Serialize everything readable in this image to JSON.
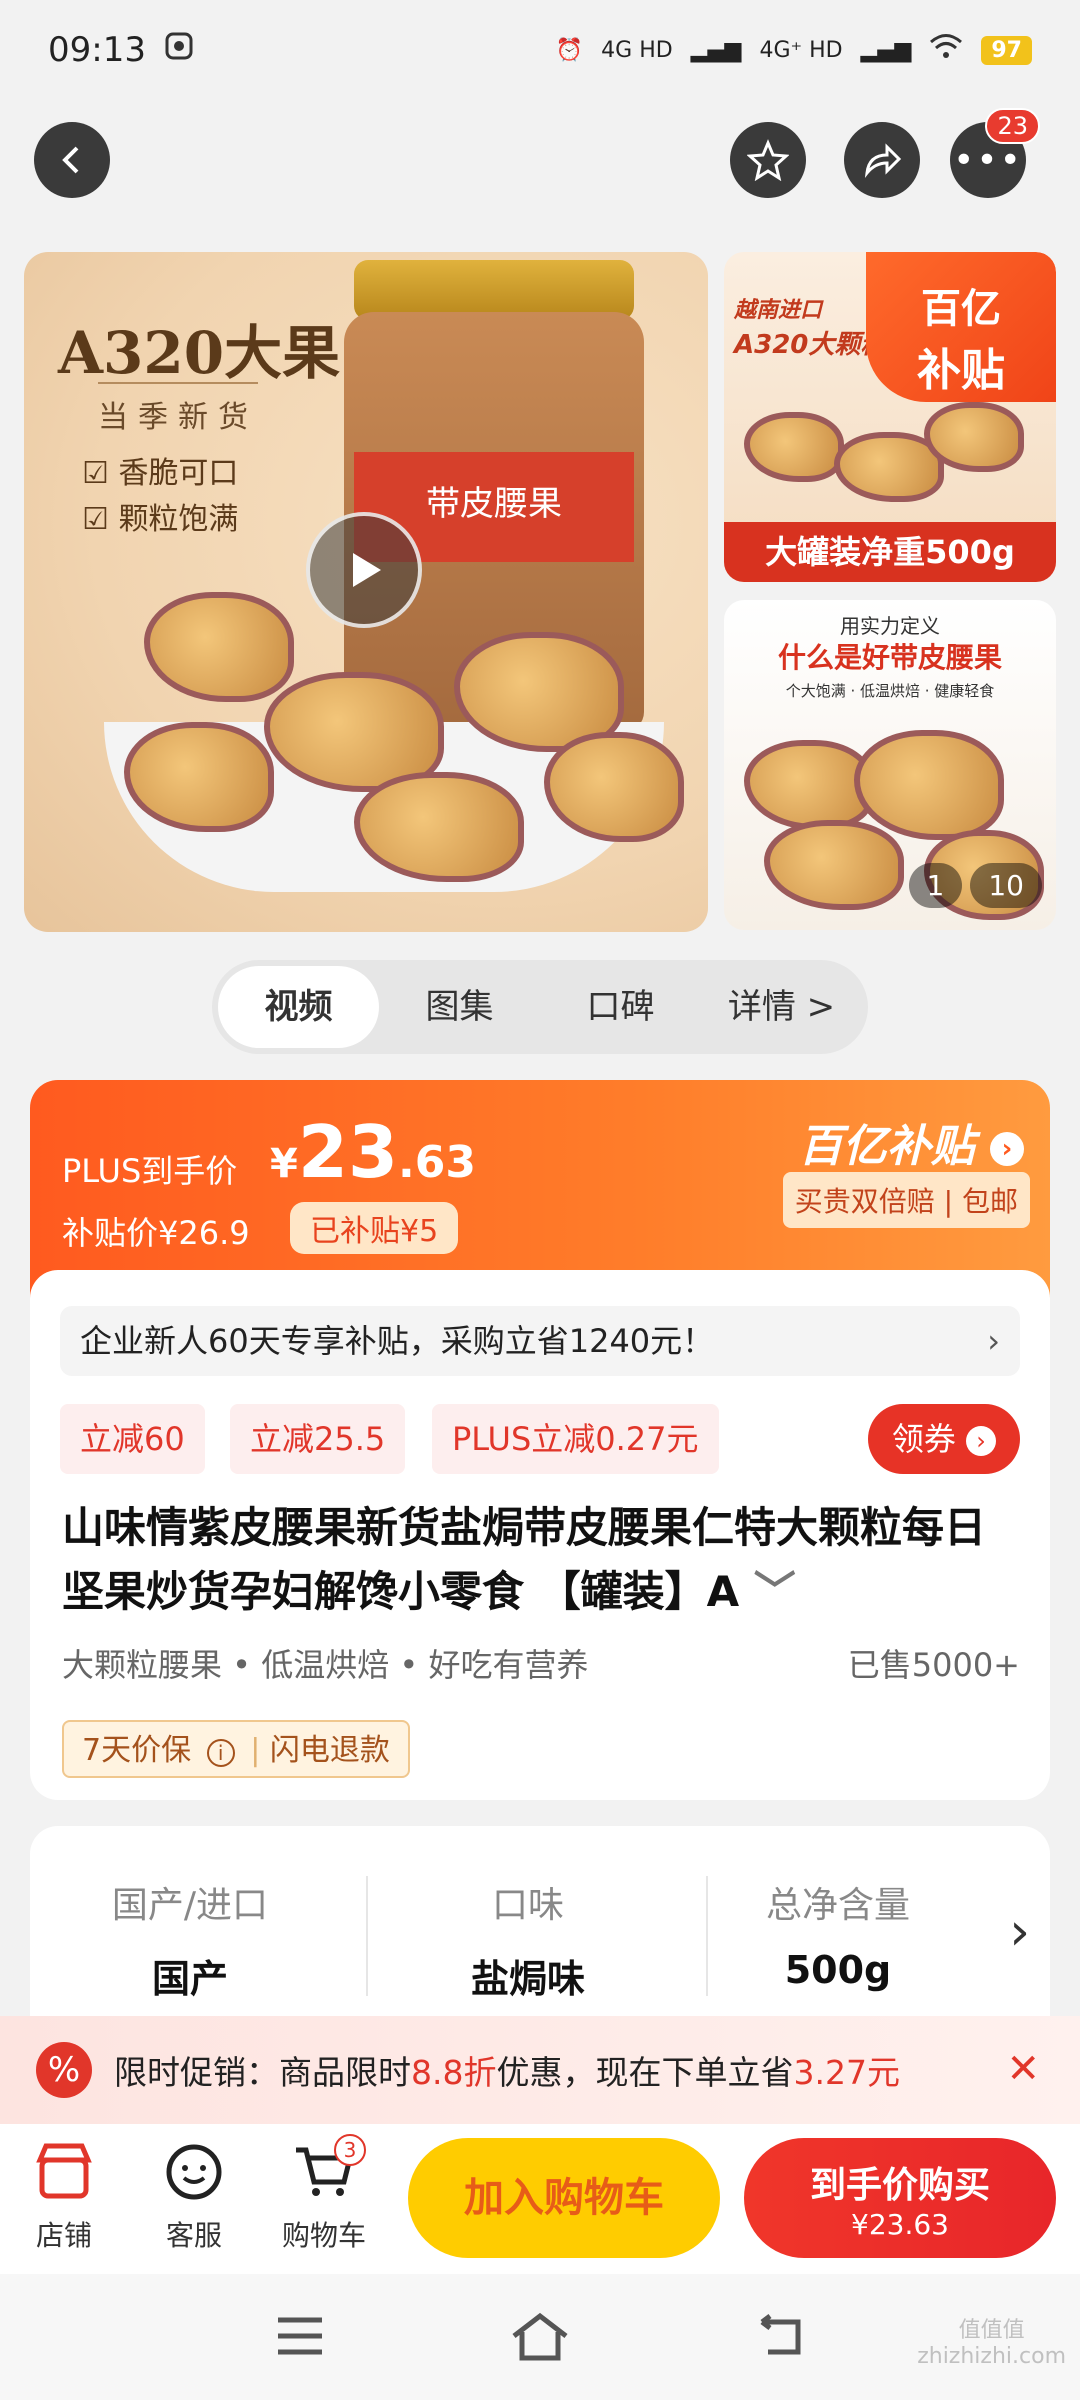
{
  "status": {
    "time": "09:13",
    "network1": "4G HD",
    "network2": "4G⁺ HD",
    "battery": "97"
  },
  "topnav": {
    "notif_count": "23"
  },
  "gallery": {
    "main_title": "A320大果",
    "main_sub": "当季新货",
    "bullet1": "香脆可口",
    "bullet2": "颗粒饱满",
    "jar_label": "带皮腰果",
    "side1_line1": "越南进口",
    "side1_line2": "A320大颗粒",
    "side1_banner": "大罐装净重500g",
    "side2_line1": "用实力定义",
    "side2_line2": "什么是好带皮腰果",
    "side2_tags": "个大饱满 · 低温烘焙 · 健康轻食",
    "subsidy_tag_line1": "百亿",
    "subsidy_tag_line2": "补贴",
    "pager_current": "1",
    "pager_total": "10"
  },
  "tabs": [
    "视频",
    "图集",
    "口碑",
    "详情 >"
  ],
  "price": {
    "plus_label": "PLUS到手价",
    "currency": "¥",
    "integer": "23",
    "decimal": ".63",
    "sub_price": "补贴价¥26.9",
    "subsidized": "已补贴¥5",
    "billion": "百亿补贴",
    "guarantee": "买贵双倍赔 | 包邮"
  },
  "notice": {
    "text": "企业新人60天专享补贴，采购立省1240元！",
    "chevron": "›"
  },
  "coupons": [
    "立减60",
    "立减25.5",
    "PLUS立减0.27元"
  ],
  "get_coupon": "领券",
  "product_title": "山味情紫皮腰果新货盐焗带皮腰果仁特大颗粒每日坚果炒货孕妇解馋小零食 【罐装】A",
  "tags": "大颗粒腰果 • 低温烘焙 • 好吃有营养",
  "sold": "已售5000+",
  "protect": {
    "days": "7天价保",
    "refund": "闪电退款"
  },
  "specs": [
    {
      "k": "国产/进口",
      "v": "国产"
    },
    {
      "k": "口味",
      "v": "盐焗味"
    },
    {
      "k": "总净含量",
      "v": "500g"
    }
  ],
  "promo": {
    "prefix": "限时促销：商品限时",
    "discount": "8.8折",
    "middle": "优惠，现在下单立省",
    "save": "3.27元"
  },
  "bottom": {
    "shop": "店铺",
    "service": "客服",
    "cart": "购物车",
    "cart_count": "3",
    "add_cart": "加入购物车",
    "buy": "到手价购买",
    "buy_price": "¥23.63"
  },
  "watermark": "值值值\nzhizhizhi.com",
  "colors": {
    "accent": "#ff5a1f",
    "red": "#e1362a",
    "yellow": "#ffcc00"
  }
}
